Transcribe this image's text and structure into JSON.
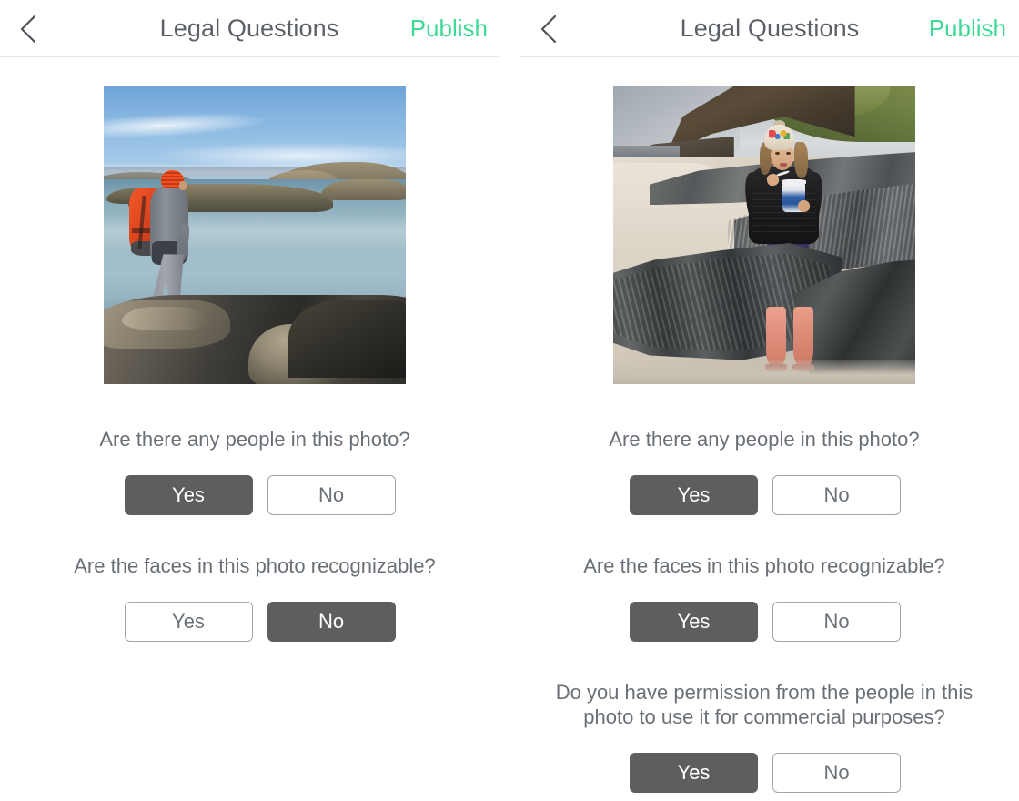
{
  "app": {
    "accent_publish_color": "#3fd996",
    "selected_button_color": "#5e5e5e",
    "unselected_border_color": "#a5a5a5",
    "text_color": "#6a7077"
  },
  "screens": [
    {
      "id": "screen-left",
      "navbar": {
        "back_icon": "chevron-left-icon",
        "title": "Legal Questions",
        "action_label": "Publish"
      },
      "photo": {
        "alt": "Hiker with orange backpack and striped beanie standing on coastal rocks overlooking the sea"
      },
      "questions": [
        {
          "text": "Are there any people in this photo?",
          "options": [
            {
              "label": "Yes",
              "selected": true
            },
            {
              "label": "No",
              "selected": false
            }
          ]
        },
        {
          "text": "Are the faces in this photo recognizable?",
          "options": [
            {
              "label": "Yes",
              "selected": false
            },
            {
              "label": "No",
              "selected": true
            }
          ]
        }
      ]
    },
    {
      "id": "screen-right",
      "navbar": {
        "back_icon": "chevron-left-icon",
        "title": "Legal Questions",
        "action_label": "Publish"
      },
      "photo": {
        "alt": "Child in black puffer jacket, white bobble hat, floral leggings and pink wellington boots sitting on rocks at a sandy beach"
      },
      "questions": [
        {
          "text": "Are there any people in this photo?",
          "options": [
            {
              "label": "Yes",
              "selected": true
            },
            {
              "label": "No",
              "selected": false
            }
          ]
        },
        {
          "text": "Are the faces in this photo recognizable?",
          "options": [
            {
              "label": "Yes",
              "selected": true
            },
            {
              "label": "No",
              "selected": false
            }
          ]
        },
        {
          "text": "Do you have permission from the people in this photo to use it for commercial purposes?",
          "options": [
            {
              "label": "Yes",
              "selected": true
            },
            {
              "label": "No",
              "selected": false
            }
          ]
        }
      ]
    }
  ]
}
